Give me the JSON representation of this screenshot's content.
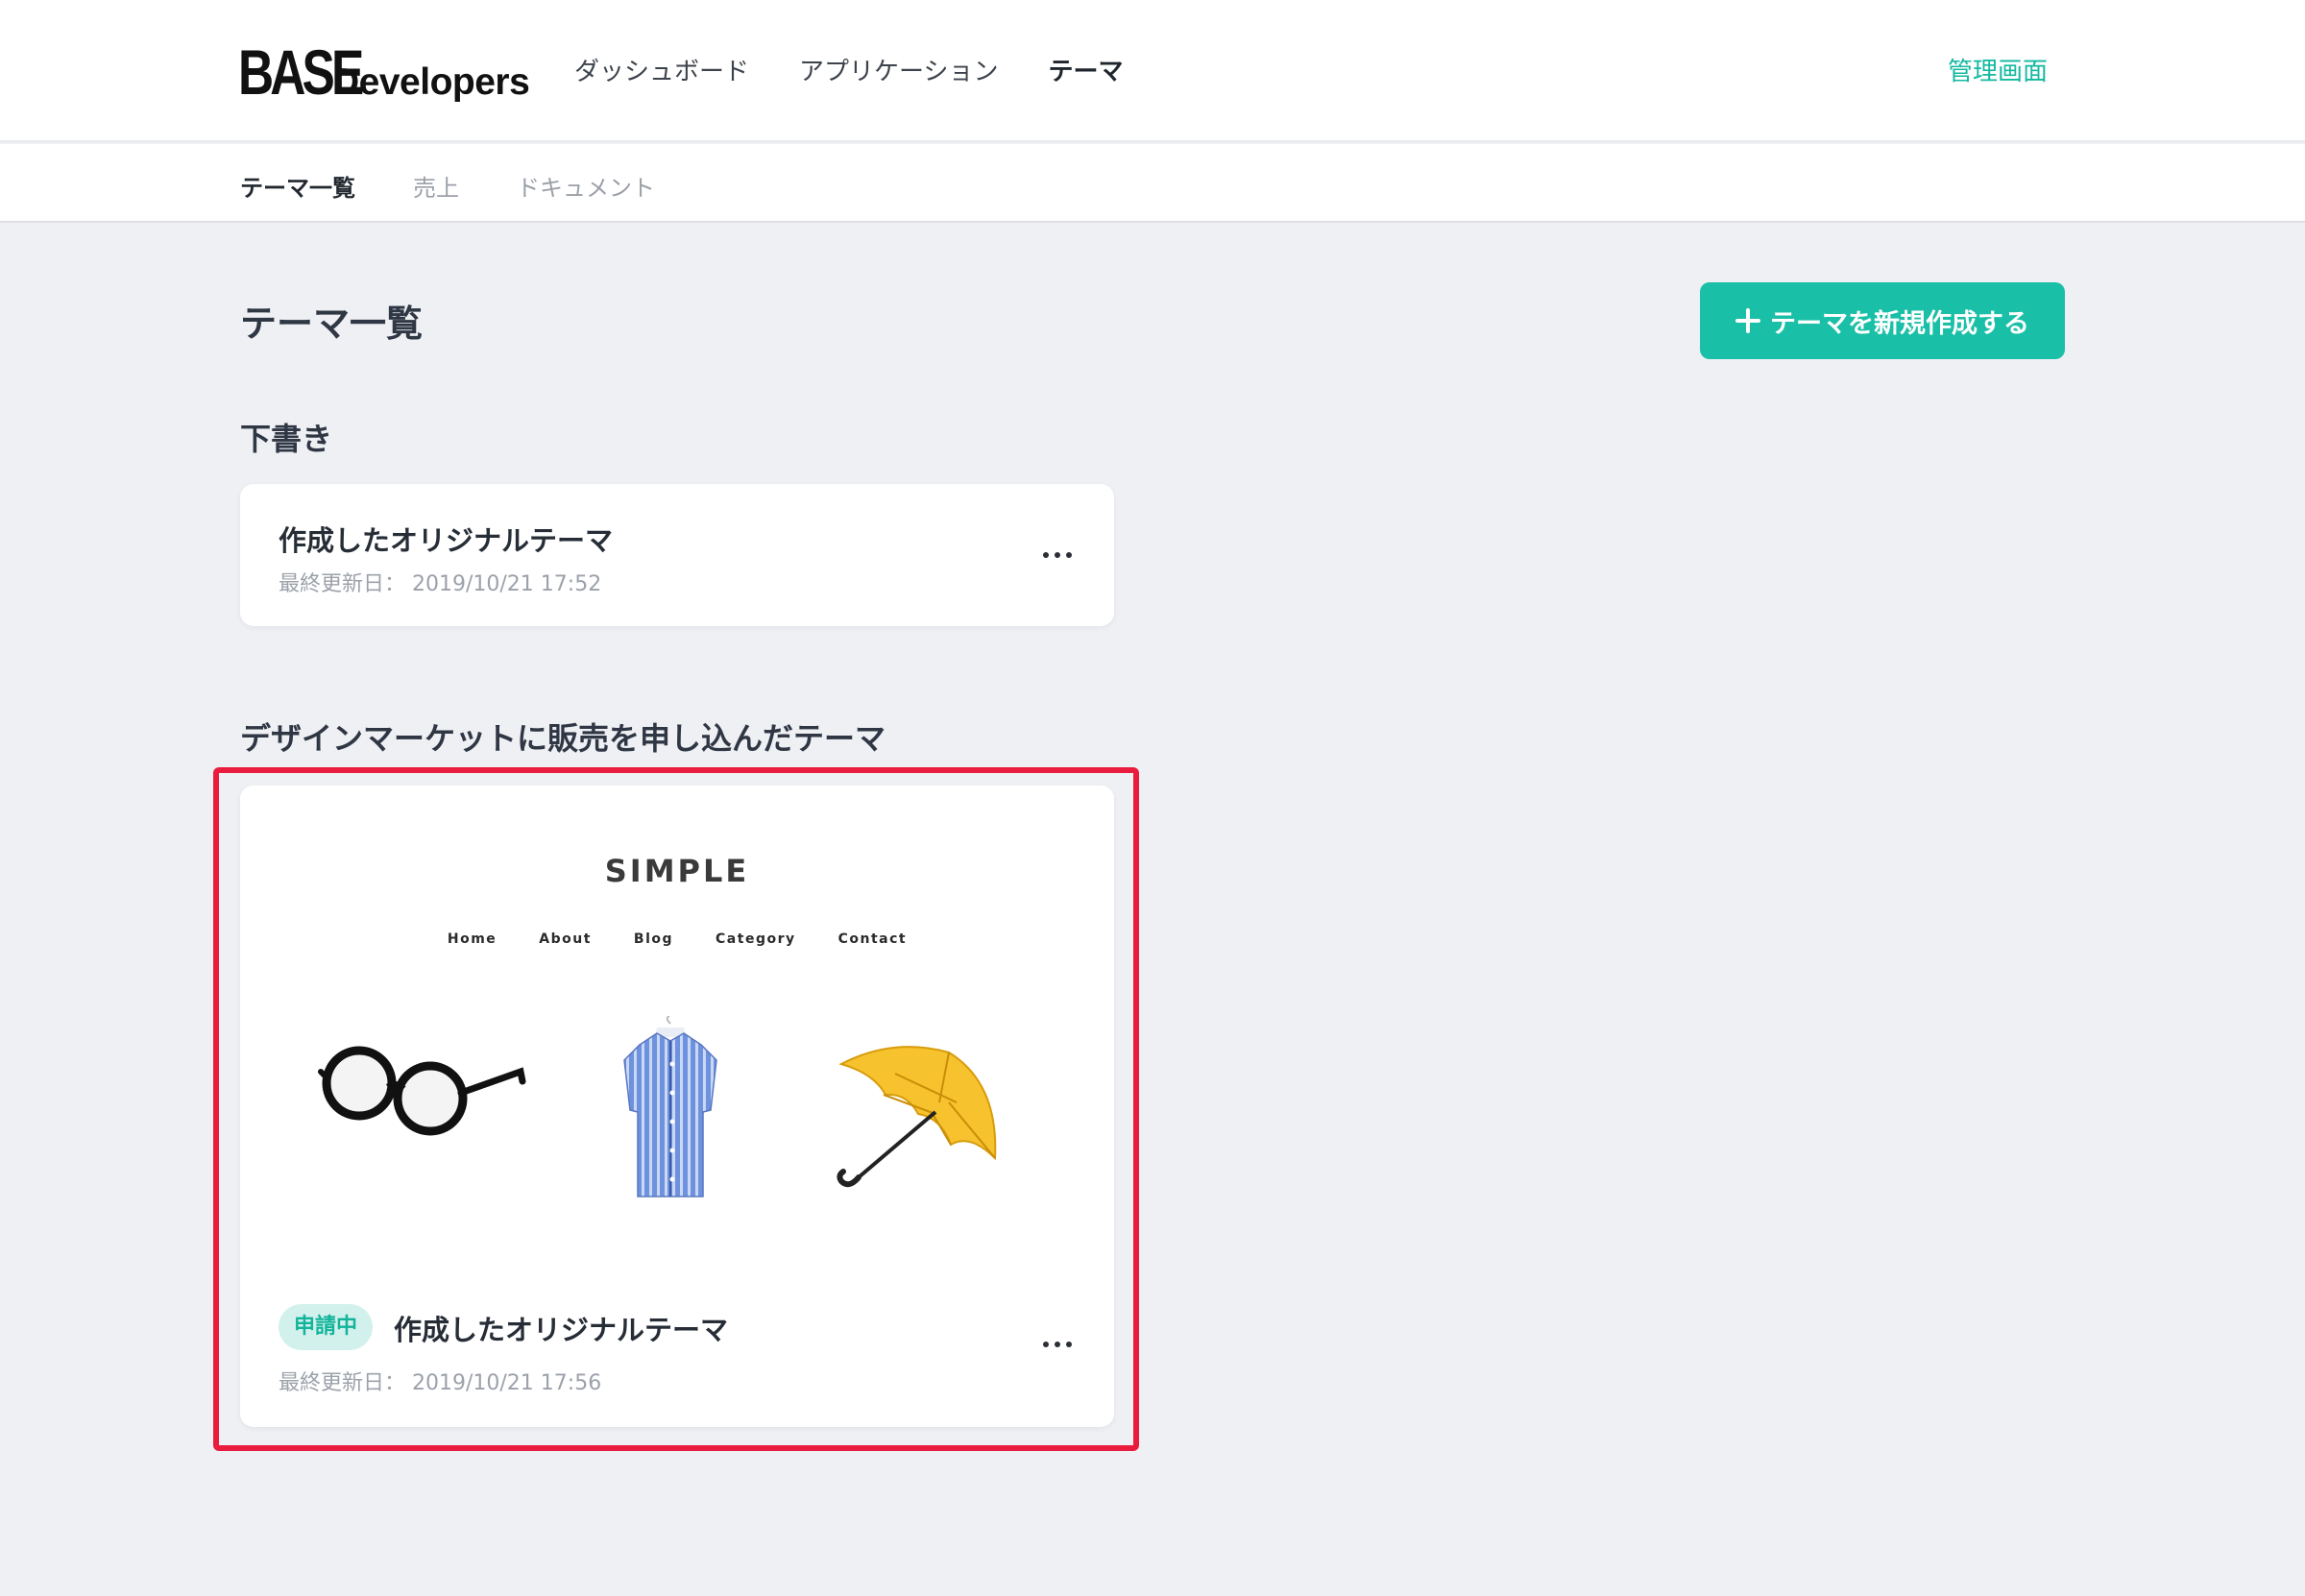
{
  "header": {
    "logo_base": "BASE",
    "logo_developers": "Developers",
    "nav": [
      "ダッシュボード",
      "アプリケーション",
      "テーマ"
    ],
    "admin_link": "管理画面"
  },
  "subnav": [
    "テーマ一覧",
    "売上",
    "ドキュメント"
  ],
  "page": {
    "title": "テーマ一覧",
    "create_button": "テーマを新規作成する"
  },
  "drafts": {
    "heading": "下書き",
    "card": {
      "title": "作成したオリジナルテーマ",
      "date": "最終更新日： 2019/10/21 17:52"
    }
  },
  "market": {
    "heading": "デザインマーケットに販売を申し込んだテーマ",
    "preview": {
      "logo": "SIMPLE",
      "nav": [
        "Home",
        "About",
        "Blog",
        "Category",
        "Contact"
      ]
    },
    "card": {
      "badge": "申請中",
      "title": "作成したオリジナルテーマ",
      "date": "最終更新日： 2019/10/21 17:56"
    }
  },
  "colors": {
    "accent": "#19bfa6",
    "highlight": "#ea1c3d",
    "background": "#eff0f4"
  }
}
